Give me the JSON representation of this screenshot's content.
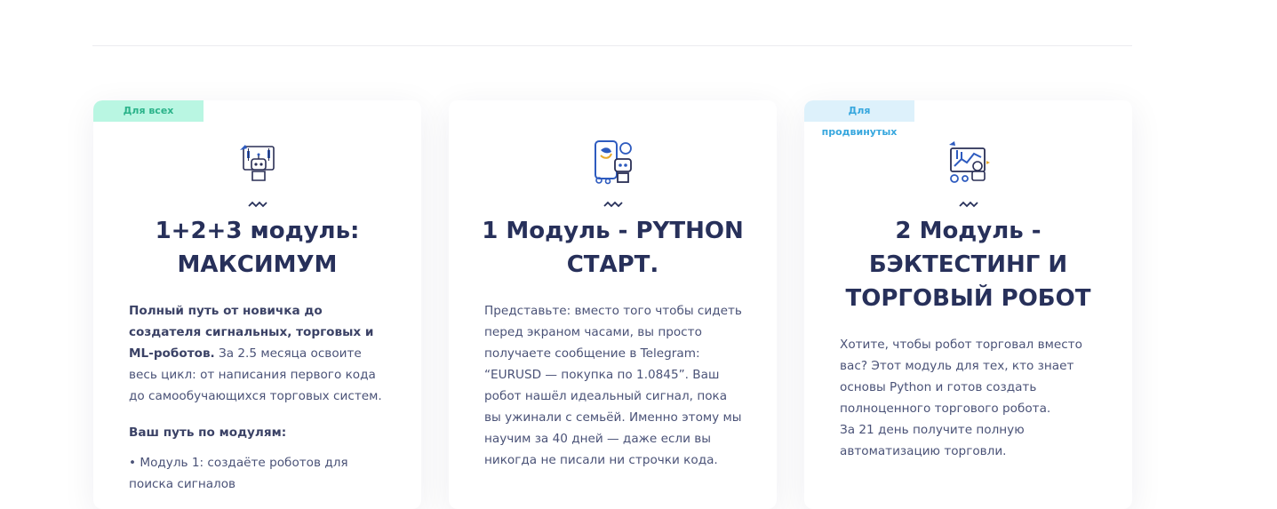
{
  "cards": [
    {
      "badge": "Для всех",
      "icon": "robot-chart-icon",
      "title": "1+2+3 модуль: МАКСИМУМ",
      "intro_bold": "Полный путь от новичка до создателя сигнальных, торговых и ML-роботов.",
      "intro_rest": " За 2.5 месяца освоите весь цикл: от написания первого кода до самообучающихся торговых систем.",
      "path_heading": "Ваш путь по модулям:",
      "module_1": "• Модуль 1: создаёте роботов для поиска сигналов"
    },
    {
      "icon": "robot-python-phone-icon",
      "title": "1 Модуль - PYTHON СТАРТ.",
      "text": "Представьте: вместо того чтобы сидеть перед экраном часами, вы просто получаете сообщение в Telegram: “EURUSD — покупка по 1.0845”. Ваш робот нашёл идеальный сигнал, пока вы ужинали с семьёй. Именно этому мы научим за 40 дней — даже если вы никогда не писали ни строчки кода."
    },
    {
      "badge": "Для продвинутых",
      "icon": "robot-trading-board-icon",
      "title": "2 Модуль - БЭКТЕСТИНГ И ТОРГОВЫЙ РОБОТ",
      "text_1": "Хотите, чтобы робот торговал вместо вас? Этот модуль для тех, кто знает основы Python и готов создать полноценного торгового робота.",
      "text_2": "За 21 день получите полную автоматизацию торговли."
    }
  ],
  "colors": {
    "title": "#27305a",
    "text": "#4a5277",
    "badge_green_bg": "#b9f6e2",
    "badge_green_text": "#2bb38a",
    "badge_blue_bg": "#ddf1fb",
    "badge_blue_text": "#37a7de",
    "icon_blue": "#2e5bbf"
  }
}
